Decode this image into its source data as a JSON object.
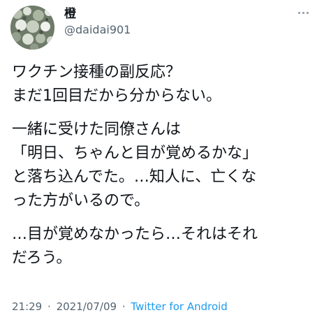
{
  "author": {
    "display_name": "橙",
    "handle": "@daidai901",
    "avatar_icon": "flower-photo-avatar"
  },
  "more_icon": "three-dots-icon",
  "tweet": {
    "paragraphs": [
      [
        "ワクチン接種の副反応？",
        "まだ1回目だから分からない。"
      ],
      [
        "一緒に受けた同僚さんは",
        "「明日、ちゃんと目が覚めるかな」",
        "と落ち込んでた。…知人に、亡くな",
        "った方がいるので。"
      ],
      [
        "…目が覚めなかったら…それはそれ",
        "だろう。"
      ]
    ]
  },
  "meta": {
    "time": "21:29",
    "separator": "·",
    "date": "2021/07/09",
    "source": "Twitter for Android"
  },
  "colors": {
    "text": "#0f1419",
    "secondary": "#536471",
    "link": "#1d9bf0"
  }
}
